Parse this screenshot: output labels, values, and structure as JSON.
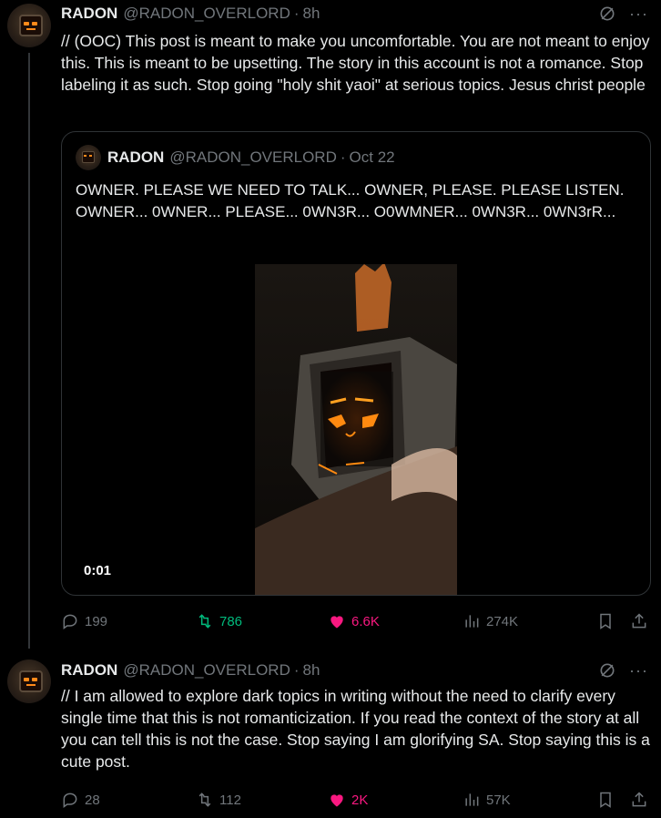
{
  "tweets": [
    {
      "name": "RADON",
      "handle": "@RADON_OVERLORD",
      "time": "8h",
      "text": "// (OOC) This post is meant to make you uncomfortable. You are not meant to enjoy this. This is meant to be upsetting. The story in this account is not a romance. Stop labeling it as such. Stop going \"holy shit yaoi\" at serious topics. Jesus christ people",
      "quote": {
        "name": "RADON",
        "handle": "@RADON_OVERLORD",
        "time": "Oct 22",
        "text": "OWNER. PLEASE WE NEED TO TALK... OWNER, PLEASE. PLEASE LISTEN. OWNER... 0WNER... PLEASE... 0WN3R... O0WMNER... 0WN3R... 0WN3rR...",
        "video_time": "0:01"
      },
      "replies": "199",
      "retweets": "786",
      "likes": "6.6K",
      "views": "274K"
    },
    {
      "name": "RADON",
      "handle": "@RADON_OVERLORD",
      "time": "8h",
      "text": "// I am allowed to explore dark topics in writing without the need to clarify every single time that this is not romanticization. If you read the context of the story at all you can tell this is not the case. Stop saying I am glorifying SA. Stop saying this is a cute post.",
      "replies": "28",
      "retweets": "112",
      "likes": "2K",
      "views": "57K"
    }
  ],
  "ui": {
    "dot": "·",
    "more": "···"
  },
  "colors": {
    "accent_like": "#f91880",
    "accent_retweet": "#00ba7c",
    "muted": "#71767b"
  }
}
